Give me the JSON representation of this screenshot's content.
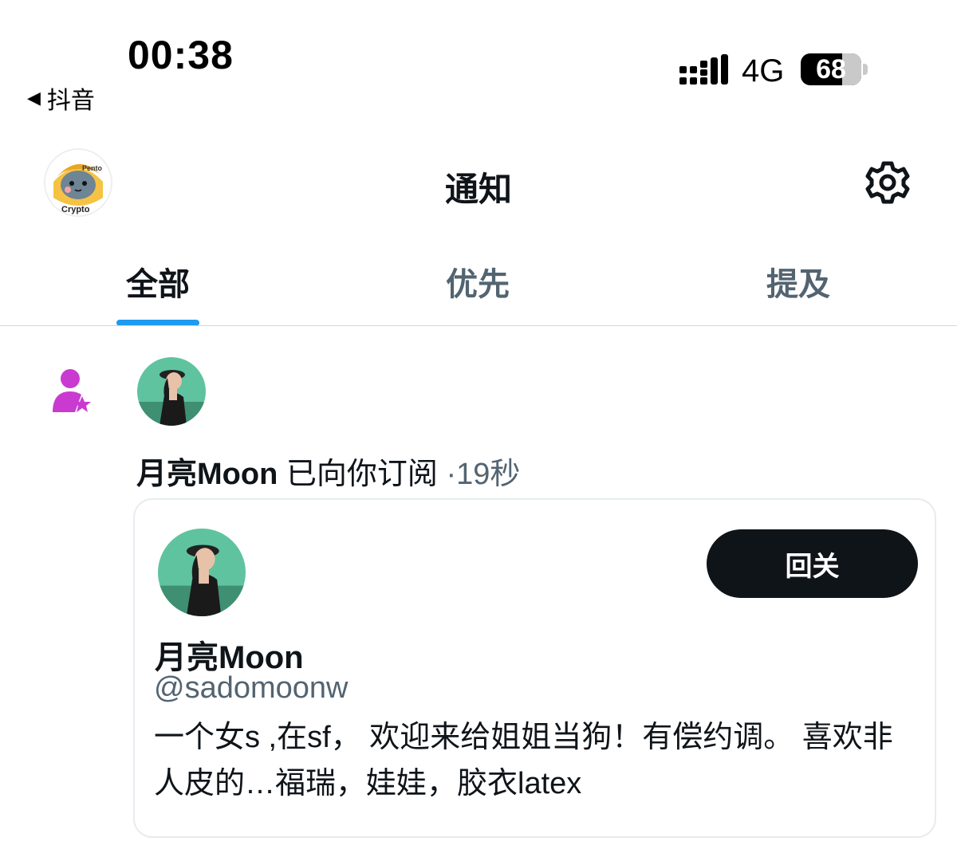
{
  "status_bar": {
    "time": "00:38",
    "back_app": "抖音",
    "network": "4G",
    "battery": "68"
  },
  "header": {
    "title": "通知",
    "avatar_badge_top": "Pento",
    "avatar_badge_bottom": "Crypto"
  },
  "tabs": [
    {
      "label": "全部",
      "active": true
    },
    {
      "label": "优先",
      "active": false
    },
    {
      "label": "提及",
      "active": false
    }
  ],
  "notification": {
    "icon": "person-star-icon",
    "user_name": "月亮Moon",
    "action": "已向你订阅",
    "separator": "·",
    "time": "19秒",
    "card": {
      "name": "月亮Moon",
      "handle": "@sadomoonw",
      "button_label": "回关",
      "bio": "一个女s ,在sf， 欢迎来给姐姐当狗！有偿约调。 喜欢非人皮的…福瑞，娃娃，胶衣latex"
    }
  },
  "colors": {
    "accent": "#1d9bf0",
    "text_primary": "#0f1419",
    "text_secondary": "#536471",
    "subscription_icon": "#c93bd0"
  }
}
